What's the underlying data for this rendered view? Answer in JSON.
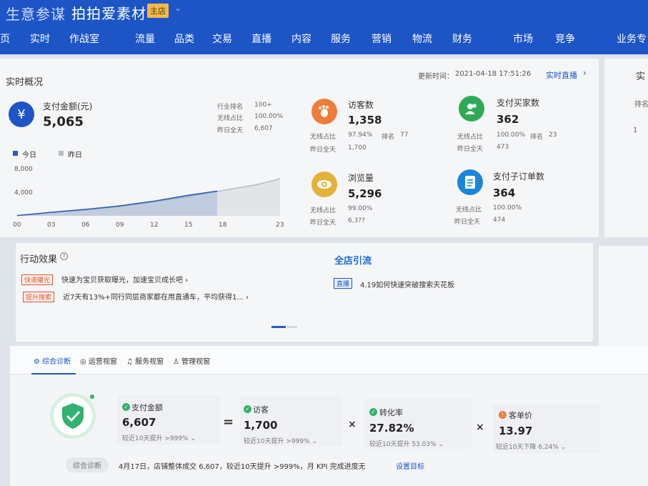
{
  "header": {
    "brand": "生意参谋",
    "shop_name": "拍拍爱素材",
    "shop_badge": "主店",
    "shop_caret": "⌄"
  },
  "nav": {
    "items": [
      "页",
      "实时",
      "作战室",
      "流量",
      "品类",
      "交易",
      "直播",
      "内容",
      "服务",
      "营销",
      "物流",
      "财务",
      "市场",
      "竞争",
      "业务专"
    ]
  },
  "overview": {
    "title": "实时概况",
    "update_label": "更新时间：",
    "update_time": "2021-04-18 17:51:26",
    "live_link": "实时直播",
    "live_arrow": "›",
    "pay": {
      "icon": "¥",
      "label": "支付金额(元)",
      "value": "5,065",
      "industry_rank_label": "行业排名",
      "industry_rank": "100+",
      "wireless_label": "无线占比",
      "wireless": "100.00%",
      "yesterday_label": "昨日全天",
      "yesterday": "6,607"
    },
    "legend": {
      "today": "今日",
      "yesterday": "昨日"
    },
    "visitors": {
      "label": "访客数",
      "value": "1,358",
      "wireless_label": "无线占比",
      "wireless": "97.94%",
      "rank_label": "排名",
      "rank": "77",
      "yesterday_label": "昨日全天",
      "yesterday": "1,700"
    },
    "buyers": {
      "label": "支付买家数",
      "value": "362",
      "wireless_label": "无线占比",
      "wireless": "100.00%",
      "rank_label": "排名",
      "rank": "23",
      "yesterday_label": "昨日全天",
      "yesterday": "473"
    },
    "pageviews": {
      "label": "浏览量",
      "value": "5,296",
      "wireless_label": "无线占比",
      "wireless": "99.00%",
      "yesterday_label": "昨日全天",
      "yesterday": "6,3??"
    },
    "suborders": {
      "label": "支付子订单数",
      "value": "364",
      "wireless_label": "无线占比",
      "wireless": "100.00%",
      "yesterday_label": "昨日全天",
      "yesterday": "474"
    }
  },
  "side_card": {
    "title": "实",
    "rank_label": "排名",
    "rank_value": "1"
  },
  "action": {
    "title": "行动效果",
    "help": "?",
    "rows": [
      {
        "tag": "快速曝光",
        "text": "快速为宝贝获取曝光，加速宝贝成长吧 ›"
      },
      {
        "tag": "提升搜索",
        "text": "近7天有13%+同行同层商家都在用直通车，平均获得1... ›"
      }
    ],
    "promo_title": "全店引流",
    "live_tag": "直播",
    "live_text": "4.19如何快速突破搜索天花板"
  },
  "tabs": [
    "综合诊断",
    "运营视窗",
    "服务视窗",
    "管理视窗"
  ],
  "diagnosis": {
    "kpis": [
      {
        "label": "支付金额",
        "value": "6,607",
        "sub": "较近10天提升 >999% ⌄"
      },
      {
        "label": "访客",
        "value": "1,700",
        "sub": "较近10天提升 >999% ⌄"
      },
      {
        "label": "转化率",
        "value": "27.82%",
        "sub": "较近10天提升 53.03% ⌄"
      },
      {
        "label": "客单价",
        "value": "13.97",
        "sub": "较近10天下降 6.24% ⌄"
      }
    ],
    "ops": [
      "=",
      "×",
      "×"
    ],
    "summary_tag": "综合诊断",
    "summary_text": "4月17日，店铺整体成交 6,607，较近10天提升 >999%，月 KPI 完成进度无",
    "summary_link": "设置目标"
  },
  "colors": {
    "topbar": "#1d55c7",
    "today_line": "#2a5cb8",
    "yesterday_line": "#b8bcc4",
    "visitors_icon": "#f07c3a",
    "buyers_icon": "#2eaa57",
    "pageviews_icon": "#e4b13a",
    "suborders_icon": "#1a86d8",
    "pay_icon": "#1d55c7"
  },
  "chart_data": {
    "type": "area",
    "title": "",
    "xlabel": "",
    "ylabel": "",
    "x_ticks": [
      "00",
      "03",
      "06",
      "09",
      "12",
      "15",
      "18",
      "23"
    ],
    "y_ticks": [
      "8,000",
      "4,000"
    ],
    "ylim": [
      0,
      8000
    ],
    "xlim": [
      0,
      23
    ],
    "grid": false,
    "legend": "top-left",
    "series": [
      {
        "name": "今日",
        "x": [
          0,
          3,
          6,
          9,
          12,
          15,
          17.5
        ],
        "values": [
          50,
          600,
          1100,
          1700,
          2500,
          3500,
          4200
        ]
      },
      {
        "name": "昨日",
        "x": [
          0,
          3,
          6,
          9,
          12,
          15,
          18,
          21,
          23
        ],
        "values": [
          50,
          550,
          1000,
          1600,
          2400,
          3300,
          4300,
          5300,
          6300
        ]
      }
    ]
  }
}
